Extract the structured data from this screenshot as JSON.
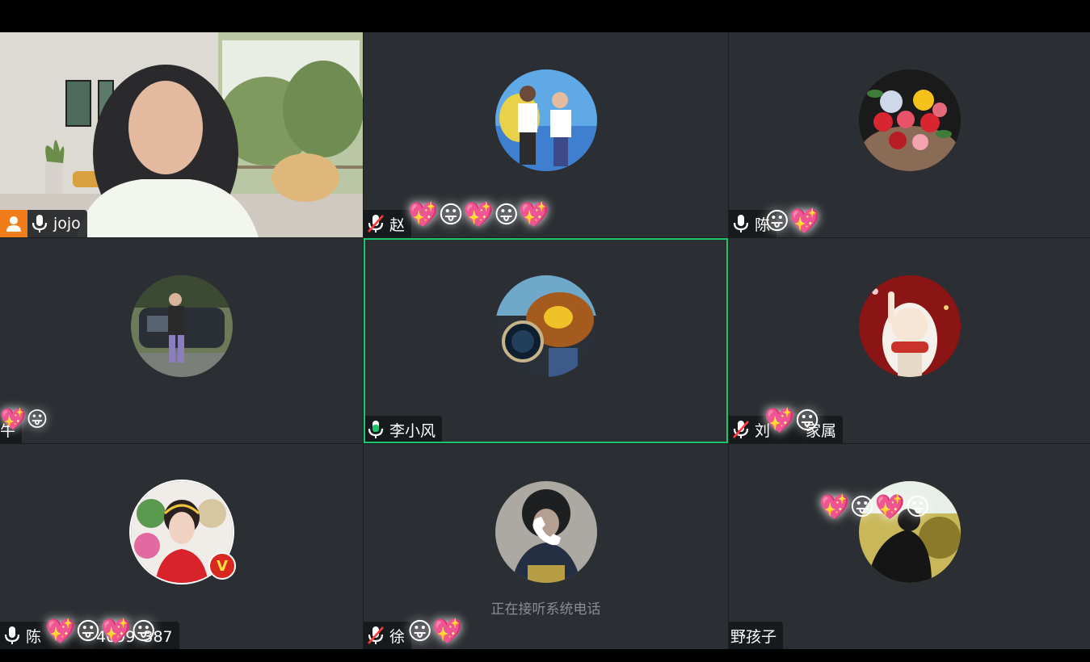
{
  "meeting": {
    "participants": [
      {
        "name": "jojo",
        "mic": "on",
        "host": true,
        "video": "live"
      },
      {
        "name": "赵",
        "mic": "muted",
        "video": "off"
      },
      {
        "name": "陈",
        "mic": "on",
        "video": "off"
      },
      {
        "name": "牛",
        "mic": "none",
        "video": "off"
      },
      {
        "name": "李小风",
        "mic": "speaking",
        "video": "off",
        "active_speaker": true
      },
      {
        "name": "刘家属",
        "name_parts": [
          "刘",
          "家属"
        ],
        "mic": "muted",
        "video": "off"
      },
      {
        "name": "陈 4099387",
        "name_parts": [
          "陈",
          "4099",
          "387"
        ],
        "mic": "on",
        "video": "off",
        "vip_badge": "V"
      },
      {
        "name": "徐",
        "mic": "muted",
        "video": "off",
        "status": "正在接听系统电话"
      },
      {
        "name": "野孩子",
        "mic": "none",
        "video": "off"
      }
    ]
  },
  "colors": {
    "active_border": "#1ec66b",
    "host_badge": "#f17c1a",
    "tile_bg": "#2b2e32",
    "muted_icon": "#ff3b3b"
  },
  "icons": [
    "user-host-icon",
    "microphone-icon",
    "microphone-muted-icon",
    "microphone-speaking-icon",
    "phone-icon"
  ]
}
